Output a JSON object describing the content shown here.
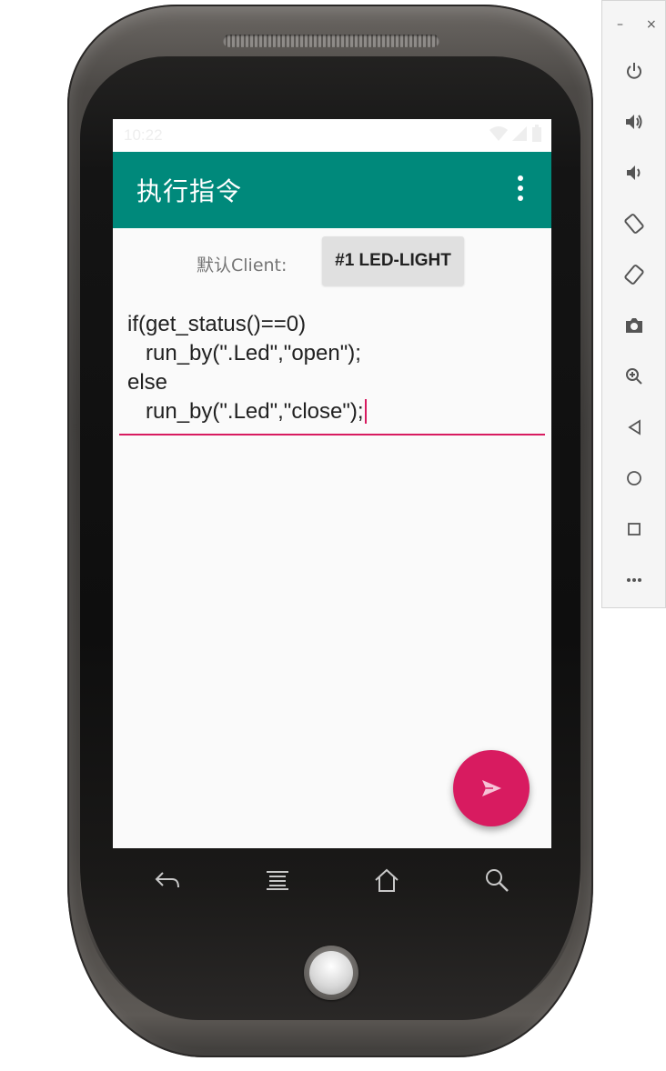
{
  "status_bar": {
    "time": "10:22"
  },
  "app_bar": {
    "title": "执行指令",
    "overflow_icon": "more-vert-icon"
  },
  "client": {
    "label": "默认Client:",
    "button_label": "#1  LED-LIGHT"
  },
  "editor": {
    "lines": [
      "if(get_status()==0)",
      "   run_by(\".Led\",\"open\");",
      "else",
      "   run_by(\".Led\",\"close\");"
    ]
  },
  "fab": {
    "icon": "send-icon"
  },
  "nav_keys": [
    "back-icon",
    "menu-icon",
    "home-icon",
    "search-icon"
  ],
  "emulator_toolbar": {
    "minimize": "–",
    "close": "×",
    "buttons": [
      "power-icon",
      "volume-up-icon",
      "volume-down-icon",
      "rotate-left-icon",
      "rotate-right-icon",
      "camera-icon",
      "zoom-icon",
      "back-icon",
      "home-icon",
      "overview-icon",
      "more-icon"
    ]
  },
  "colors": {
    "app_bar": "#00897b",
    "accent": "#d81b60",
    "background": "#fafafa"
  }
}
